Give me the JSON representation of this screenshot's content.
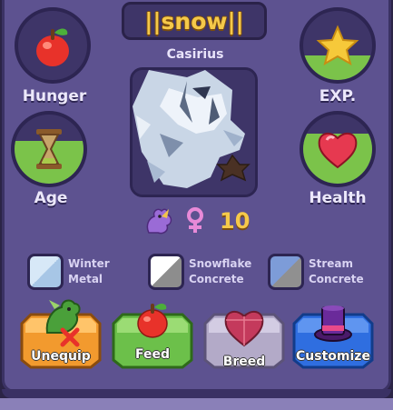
{
  "header": {
    "name": "||snow||",
    "creature": "Casirius"
  },
  "stats": {
    "hunger": {
      "label": "Hunger",
      "icon": "apple-icon",
      "fill": 0.0
    },
    "exp": {
      "label": "EXP.",
      "icon": "star-icon",
      "fill": 0.35
    },
    "age": {
      "label": "Age",
      "icon": "hourglass-icon",
      "fill": 0.62
    },
    "health": {
      "label": "Health",
      "icon": "heart-icon",
      "fill": 0.72
    }
  },
  "info": {
    "level": "10",
    "icons": [
      "purple-dragon-icon",
      "female-symbol-icon"
    ]
  },
  "genes": [
    {
      "line1": "Winter",
      "line2": "Metal",
      "color_a": "#bcd8ef",
      "color_b": "#a7c6e6"
    },
    {
      "line1": "Snowflake",
      "line2": "Concrete",
      "color_a": "#ffffff",
      "color_b": "#8d8d8d"
    },
    {
      "line1": "Stream",
      "line2": "Concrete",
      "color_a": "#7d9cd8",
      "color_b": "#909090"
    }
  ],
  "buttons": {
    "unequip": {
      "label": "Unequip",
      "color": "#f29a2e"
    },
    "feed": {
      "label": "Feed",
      "color": "#6cc04a"
    },
    "breed": {
      "label": "Breed",
      "color": "#b3aac8"
    },
    "customize": {
      "label": "Customize",
      "color": "#2f6ee0"
    }
  },
  "colors": {
    "panel": "#5d5290",
    "accent_gold": "#f5c94a",
    "fill_green": "#7bc34a"
  }
}
